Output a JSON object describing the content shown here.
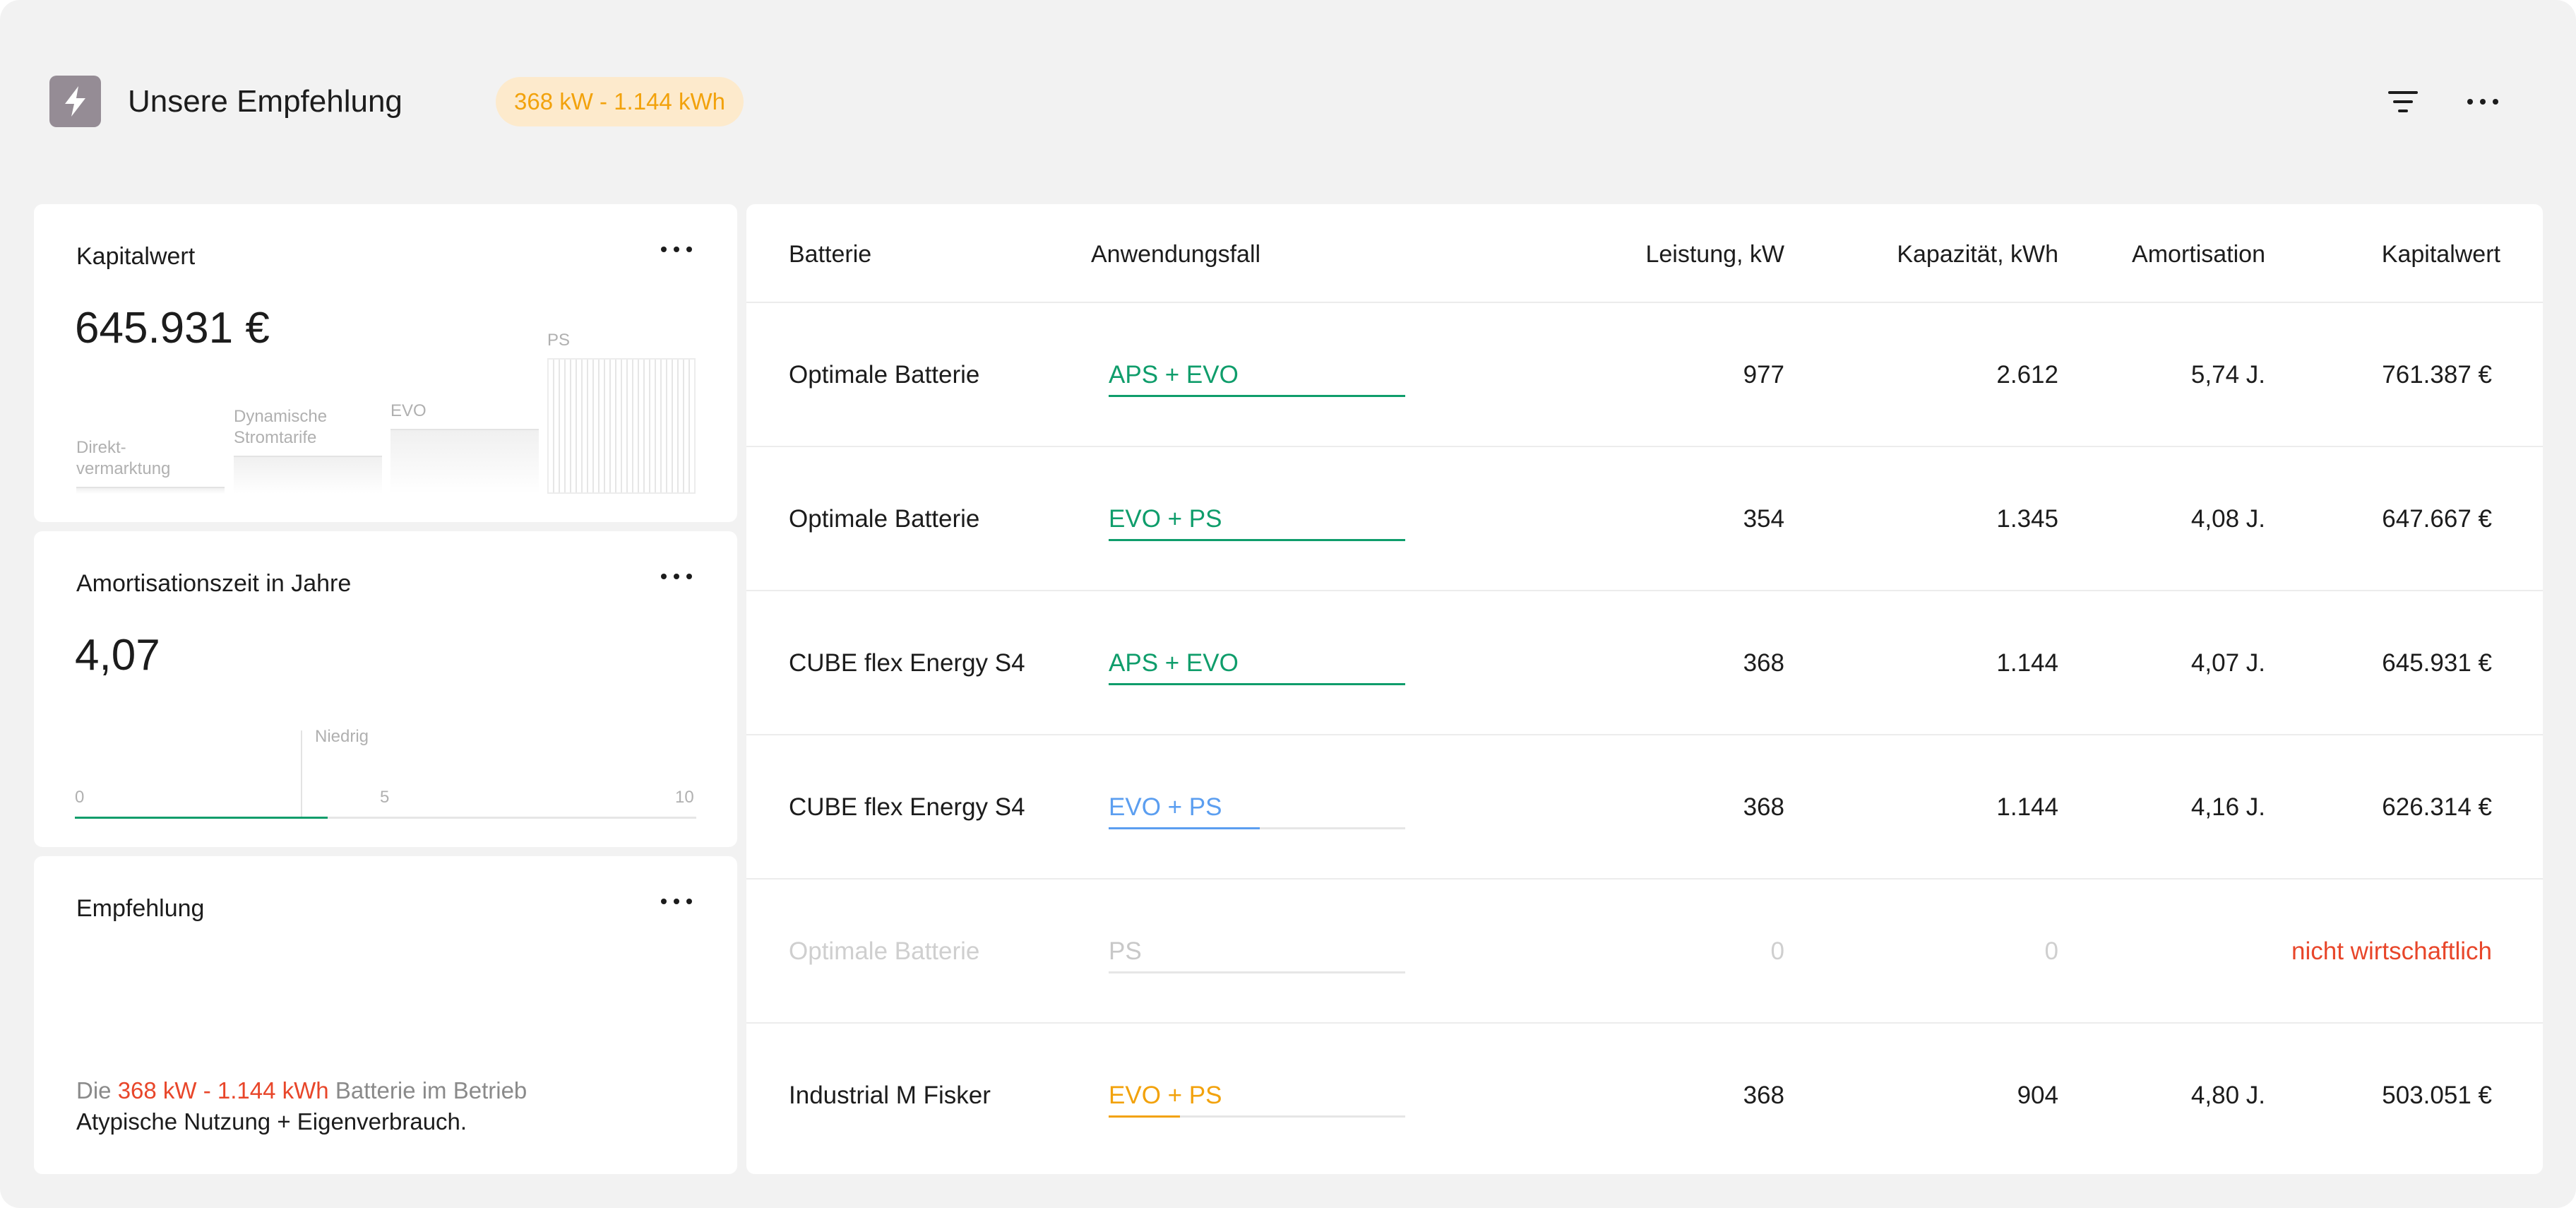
{
  "header": {
    "title": "Unsere Empfehlung",
    "badge": "368 kW - 1.144 kWh",
    "icons": [
      "bolt-icon",
      "filter-icon",
      "more-icon"
    ]
  },
  "kapitalwert_card": {
    "title": "Kapitalwert",
    "value": "645.931 €",
    "bars": [
      {
        "label_1": "Direkt-",
        "label_2": "vermarktung",
        "level": 0.05
      },
      {
        "label_1": "Dynamische",
        "label_2": "Stromtarife",
        "level": 0.28
      },
      {
        "label_1": "EVO",
        "label_2": "",
        "level": 0.48
      },
      {
        "label_1": "PS",
        "label_2": "",
        "level": 1.0
      }
    ]
  },
  "amortisation_card": {
    "title": "Amortisationszeit in Jahre",
    "value": "4,07",
    "marker_label": "Niedrig",
    "ticks": [
      "0",
      "5",
      "10"
    ],
    "progress": 0.407
  },
  "empfehlung_card": {
    "title": "Empfehlung",
    "line1_prefix": "Die",
    "line1_highlight": "368 kW - 1.144 kWh",
    "line1_suffix": "Batterie im Betrieb",
    "line2": "Atypische Nutzung + Eigenverbrauch."
  },
  "table": {
    "columns": [
      "Batterie",
      "Anwendungsfall",
      "Leistung, kW",
      "Kapazität, kWh",
      "Amortisation",
      "Kapitalwert"
    ],
    "rows": [
      {
        "battery": "Optimale Batterie",
        "usecase": "APS + EVO",
        "usecase_color": "#0f9d6b",
        "usecase_fill": 1.0,
        "power": "977",
        "capacity": "2.612",
        "amortisation": "5,74 J.",
        "npv": "761.387 €",
        "muted": false
      },
      {
        "battery": "Optimale Batterie",
        "usecase": "EVO + PS",
        "usecase_color": "#0f9d6b",
        "usecase_fill": 1.0,
        "power": "354",
        "capacity": "1.345",
        "amortisation": "4,08 J.",
        "npv": "647.667 €",
        "muted": false
      },
      {
        "battery": "CUBE flex Energy S4",
        "usecase": "APS + EVO",
        "usecase_color": "#0f9d6b",
        "usecase_fill": 1.0,
        "power": "368",
        "capacity": "1.144",
        "amortisation": "4,07 J.",
        "npv": "645.931 €",
        "muted": false
      },
      {
        "battery": "CUBE flex Energy S4",
        "usecase": "EVO + PS",
        "usecase_color": "#5b9ef0",
        "usecase_fill": 0.51,
        "power": "368",
        "capacity": "1.144",
        "amortisation": "4,16 J.",
        "npv": "626.314 €",
        "muted": false
      },
      {
        "battery": "Optimale Batterie",
        "usecase": "PS",
        "usecase_color": "#c8c8c8",
        "usecase_fill": 0.0,
        "power": "0",
        "capacity": "0",
        "amortisation": "",
        "npv": "nicht wirtschaftlich",
        "muted": true
      },
      {
        "battery": "Industrial M Fisker",
        "usecase": "EVO + PS",
        "usecase_color": "#f2a20c",
        "usecase_fill": 0.24,
        "power": "368",
        "capacity": "904",
        "amortisation": "4,80 J.",
        "npv": "503.051 €",
        "muted": false
      }
    ]
  }
}
